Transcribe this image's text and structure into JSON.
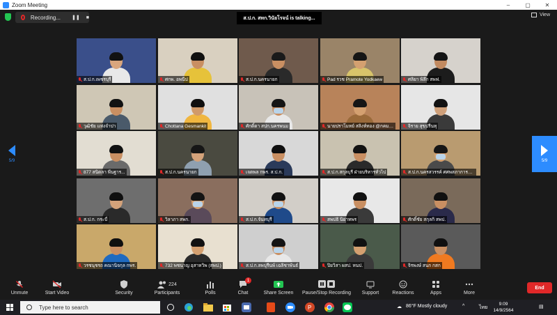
{
  "window": {
    "title": "Zoom Meeting",
    "minimize": "–",
    "maximize": "▢",
    "close": "✕"
  },
  "recording": {
    "label": "Recording...",
    "pause": "❚❚",
    "stop": "■"
  },
  "talking": "ส.ป.ก. สทก.วินัยโรจน์ is talking...",
  "view_label": "View",
  "page_indicator_left": "5/9",
  "page_indicator_right": "5/9",
  "participants_grid": [
    {
      "name": "ส.ป.ก.เพชรบุรี",
      "bg": "#3a4f8a",
      "skin": "#d9a67d",
      "cloth": "#e8e8e8",
      "hair": "#111",
      "mask": false
    },
    {
      "name": "ศกพ. อพนีป",
      "bg": "#d9d0c0",
      "skin": "#c98f62",
      "cloth": "#e6c23a",
      "hair": "#101010",
      "mask": false
    },
    {
      "name": "ส.ป.ก.นครนายก",
      "bg": "#6f5a4c",
      "skin": "#c98f62",
      "cloth": "#2a2a2a",
      "hair": "#1a1a1a",
      "mask": false
    },
    {
      "name": "Pad รวช Pramote Yodkaew",
      "bg": "#9a8468",
      "skin": "#d4a070",
      "cloth": "#d8c46a",
      "hair": "#151515",
      "mask": false
    },
    {
      "name": "ศลิยา พิลึก สพฟ.",
      "bg": "#d6d2cc",
      "skin": "#c28a60",
      "cloth": "#1c1c1c",
      "hair": "#141414",
      "mask": false
    },
    {
      "name": "วุฒิชัย แห่งจำปา",
      "bg": "#cfc7b5",
      "skin": "#c98f62",
      "cloth": "#4a5a6a",
      "hair": "#121212",
      "mask": false
    },
    {
      "name": "Chottana Gesmankit",
      "bg": "#e0e0e0",
      "skin": "#d19a6a",
      "cloth": "#f0b640",
      "hair": "#0f0f0f",
      "mask": false
    },
    {
      "name": "ศักดิ์ดา สปก.นครพนม",
      "bg": "#c8c2b8",
      "skin": "#c98f62",
      "cloth": "#e8e8e8",
      "hair": "#151515",
      "mask": true
    },
    {
      "name": "นายปราโมทย์ สลิงห์ทอง @กคม. สาน...",
      "bg": "#b8835a",
      "skin": "#d4a070",
      "cloth": "#9a6a3a",
      "hair": "#161616",
      "mask": false
    },
    {
      "name": "จิราย สุขปรีนทุ",
      "bg": "#e6e6e6",
      "skin": "#cfa07a",
      "cloth": "#3a3a3a",
      "hair": "#121212",
      "mask": false
    },
    {
      "name": "877 สนิดลา พีนฐาร...",
      "bg": "#e2ddd2",
      "skin": "#c98f62",
      "cloth": "#6a6a6a",
      "hair": "#111",
      "mask": false
    },
    {
      "name": "ส.ป.ก.นครนายก",
      "bg": "#4a4a40",
      "skin": "#d3a27a",
      "cloth": "#8fa0b0",
      "hair": "#161616",
      "mask": false
    },
    {
      "name": "เจตพล กพร. ส.ป.ก.",
      "bg": "#d8d8d8",
      "skin": "#c98f62",
      "cloth": "#2a3a5a",
      "hair": "#0f0f0f",
      "mask": false
    },
    {
      "name": "ส.ป.ก.สกุลบุรี ฝ่ายบริหารทั่วไป",
      "bg": "#c9c2b0",
      "skin": "#c98f62",
      "cloth": "#2a2a2a",
      "hair": "#121212",
      "mask": false
    },
    {
      "name": "ส.ป.ก.นครสวรรค์ ศศพสภาการคลัง",
      "bg": "#b99b70",
      "skin": "#d4a070",
      "cloth": "#4a4a4a",
      "hair": "#161616",
      "mask": true
    },
    {
      "name": "ส.ป.ก. กระบี่",
      "bg": "#6e6e6e",
      "skin": "#d3a27a",
      "cloth": "#2a2a2a",
      "hair": "#0f0f0f",
      "mask": false
    },
    {
      "name": "วิลาภา สพก.",
      "bg": "#8a6e5e",
      "skin": "#d4a070",
      "cloth": "#5a4a5a",
      "hair": "#141414",
      "mask": true
    },
    {
      "name": "ส.ป.ก.จันทบุรี",
      "bg": "#d2cec8",
      "skin": "#c98f62",
      "cloth": "#1f4a8a",
      "hair": "#121212",
      "mask": true
    },
    {
      "name": "สพปธิ นิยาทพร",
      "bg": "#e8e8e8",
      "skin": "#c98f62",
      "cloth": "#3a3a3a",
      "hair": "#111",
      "mask": false
    },
    {
      "name": "ศักดิ์ชัย สกุลกิ สพป.",
      "bg": "#7a6a5a",
      "skin": "#c98f62",
      "cloth": "#2a2a4a",
      "hair": "#101010",
      "mask": false
    },
    {
      "name": "วรชนุชรถ คณานิจกุล กพร.",
      "bg": "#c9a86a",
      "skin": "#c98f62",
      "cloth": "#1f6ac0",
      "hair": "#0f0f0f",
      "mask": false
    },
    {
      "name": "732 พชนาญ อุสาหวิพ (สพป.)",
      "bg": "#e8e0d0",
      "skin": "#d4a070",
      "cloth": "#2a2a2a",
      "hair": "#121212",
      "mask": false
    },
    {
      "name": "ส.ป.ก.ลพบุรีนพ์ เฉลิชาพันธ์",
      "bg": "#cfcfcf",
      "skin": "#c98f62",
      "cloth": "#e8e8e8",
      "hair": "#141414",
      "mask": true
    },
    {
      "name": "ปิยวิสา ผสป. หนป.",
      "bg": "#4a5a4a",
      "skin": "#d4a070",
      "cloth": "#3a3a3a",
      "hair": "#111",
      "mask": false
    },
    {
      "name": "จิรพงษ์ สนก กสก",
      "bg": "#5a5a5a",
      "skin": "#c98f62",
      "cloth": "#f07a20",
      "hair": "#101010",
      "mask": false
    }
  ],
  "toolbar": {
    "unmute": "Unmute",
    "start_video": "Start Video",
    "security": "Security",
    "participants": "Participants",
    "participants_count": "224",
    "polls": "Polls",
    "chat": "Chat",
    "chat_badge": "1",
    "share_screen": "Share Screen",
    "record": "Pause/Stop Recording",
    "support": "Support",
    "reactions": "Reactions",
    "apps": "Apps",
    "more": "More",
    "end": "End"
  },
  "taskbar": {
    "search_placeholder": "Type here to search",
    "weather": "86°F  Mostly cloudy",
    "lang": "ไทย",
    "time": "9:09",
    "date": "14/9/2564"
  },
  "colors": {
    "accent": "#2d8cff",
    "danger": "#e02828",
    "share": "#23c552"
  }
}
